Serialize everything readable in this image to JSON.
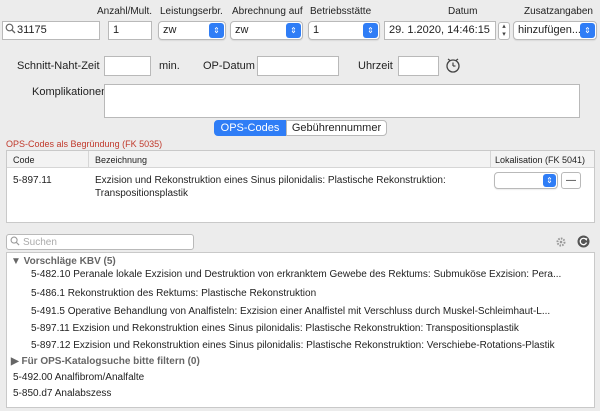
{
  "top": {
    "search_value": "31175",
    "anzahl_label": "Anzahl/Mult.",
    "anzahl_value": "1",
    "leistung_label": "Leistungserbr.",
    "leistung_value": "zw",
    "abrechnung_label": "Abrechnung auf",
    "abrechnung_value": "zw",
    "betrieb_label": "Betriebsstätte",
    "betrieb_value": "1",
    "datum_label": "Datum",
    "datum_value": "29.  1.2020, 14:46:15",
    "zusatz_label": "Zusatzangaben",
    "zusatz_value": "hinzufügen..."
  },
  "form": {
    "snz_label": "Schnitt-Naht-Zeit",
    "snz_value": "",
    "min_unit": "min.",
    "ops_datum_label": "OP-Datum",
    "ops_datum_value": "",
    "uhrzeit_label": "Uhrzeit",
    "uhrzeit_value": "",
    "kompl_label": "Komplikationen",
    "kompl_value": ""
  },
  "tabs": {
    "ops_codes": "OPS-Codes",
    "gebuehren": "Gebührennummer",
    "active": "ops_codes"
  },
  "ops_section": {
    "title": "OPS-Codes als Begründung (FK 5035)",
    "col_code": "Code",
    "col_bez": "Bezeichnung",
    "col_lok": "Lokalisation (FK 5041)",
    "rows": [
      {
        "code": "5-897.11",
        "line1": "Exzision und Rekonstruktion eines Sinus pilonidalis: Plastische Rekonstruktion:",
        "line2": "Transpositionsplastik",
        "lokalisation": "",
        "remove": "—"
      }
    ]
  },
  "catalog": {
    "search_placeholder": "Suchen",
    "group_kbv_header": "▼ Vorschläge KBV (5)",
    "kbv_items": [
      {
        "code": "5-482.10",
        "text": "Peranale lokale Exzision und Destruktion von erkranktem Gewebe des Rektums: Submuköse Exzision: Pera..."
      },
      {
        "code": "5-486.1",
        "text": "Rekonstruktion des Rektums: Plastische Rekonstruktion"
      },
      {
        "code": "5-491.5",
        "text": "Operative Behandlung von Analfisteln: Exzision einer Analfistel mit Verschluss durch Muskel-Schleimhaut-L..."
      },
      {
        "code": "5-897.11",
        "text": "Exzision und Rekonstruktion eines Sinus pilonidalis: Plastische Rekonstruktion: Transpositionsplastik"
      },
      {
        "code": "5-897.12",
        "text": "Exzision und Rekonstruktion eines Sinus pilonidalis: Plastische Rekonstruktion: Verschiebe-Rotations-Plastik"
      }
    ],
    "group_filter_header": "▶ Für OPS-Katalogsuche bitte filtern (0)",
    "other_items": [
      {
        "code": "5-492.00",
        "text": "Analfibrom/Analfalte"
      },
      {
        "code": "5-850.d7",
        "text": "Analabszess"
      }
    ]
  },
  "colors": {
    "accent": "#2f7df6",
    "section_title": "#c0392b"
  }
}
